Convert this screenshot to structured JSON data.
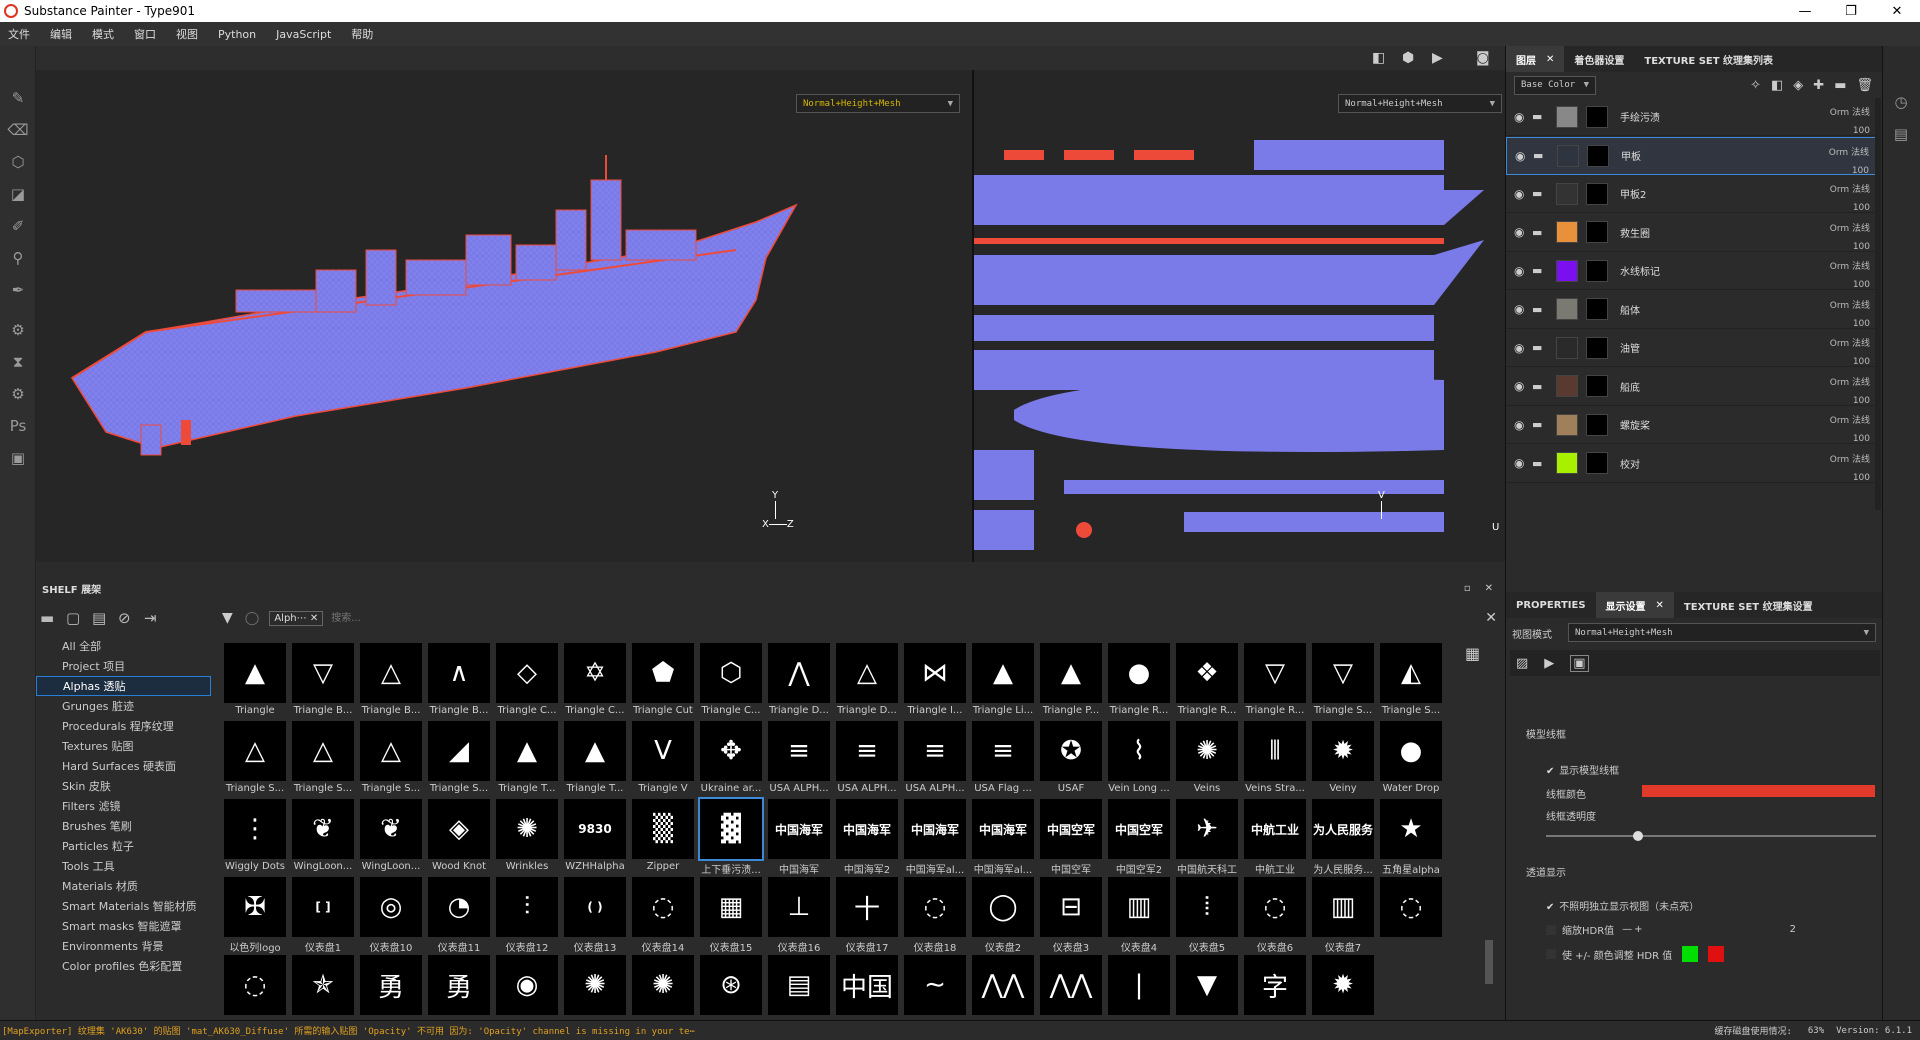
{
  "window": {
    "title": "Substance Painter - Type901",
    "minimize": "—",
    "maximize": "❐",
    "close": "✕"
  },
  "menu": [
    "文件",
    "编辑",
    "模式",
    "窗口",
    "视图",
    "Python",
    "JavaScript",
    "帮助"
  ],
  "viewport": {
    "mode_3d": "Normal+Height+Mesh",
    "mode_2d": "Normal+Height+Mesh",
    "axis_y": "Y",
    "axis_x": "X",
    "axis_z": "Z",
    "axis_u": "U",
    "axis_v": "V"
  },
  "shelf": {
    "title": "SHELF 展架",
    "filter_tag": "Alph⋯",
    "search_placeholder": "搜索...",
    "categories": [
      "All 全部",
      "Project 项目",
      "Alphas 透贴",
      "Grunges 脏迹",
      "Procedurals 程序纹理",
      "Textures 贴图",
      "Hard Surfaces 硬表面",
      "Skin 皮肤",
      "Filters 滤镜",
      "Brushes 笔刷",
      "Particles 粒子",
      "Tools 工具",
      "Materials 材质",
      "Smart Materials 智能材质",
      "Smart masks 智能遮罩",
      "Environments 背景",
      "Color profiles 色彩配置"
    ],
    "selected_category": "Alphas 透贴",
    "items": [
      {
        "label": "Triangle",
        "glyph": "▲"
      },
      {
        "label": "Triangle B...",
        "glyph": "▽"
      },
      {
        "label": "Triangle B...",
        "glyph": "△"
      },
      {
        "label": "Triangle B...",
        "glyph": "∧"
      },
      {
        "label": "Triangle C...",
        "glyph": "◇"
      },
      {
        "label": "Triangle C...",
        "glyph": "✡"
      },
      {
        "label": "Triangle Cut",
        "glyph": "⬟"
      },
      {
        "label": "Triangle C...",
        "glyph": "⬡"
      },
      {
        "label": "Triangle D...",
        "glyph": "⋀"
      },
      {
        "label": "Triangle D...",
        "glyph": "△"
      },
      {
        "label": "Triangle I...",
        "glyph": "⋈"
      },
      {
        "label": "Triangle Li...",
        "glyph": "▲"
      },
      {
        "label": "Triangle P...",
        "glyph": "▲"
      },
      {
        "label": "Triangle R...",
        "glyph": "●"
      },
      {
        "label": "Triangle R...",
        "glyph": "❖"
      },
      {
        "label": "Triangle R...",
        "glyph": "▽"
      },
      {
        "label": "Triangle S...",
        "glyph": "▽"
      },
      {
        "label": "Triangle S...",
        "glyph": "◭"
      },
      {
        "label": "Triangle S...",
        "glyph": "△"
      },
      {
        "label": "Triangle S...",
        "glyph": "△"
      },
      {
        "label": "Triangle S...",
        "glyph": "△"
      },
      {
        "label": "Triangle S...",
        "glyph": "◢"
      },
      {
        "label": "Triangle T...",
        "glyph": "▲"
      },
      {
        "label": "Triangle T...",
        "glyph": "▲"
      },
      {
        "label": "Triangle V",
        "glyph": "V"
      },
      {
        "label": "Ukraine ar...",
        "glyph": "✥"
      },
      {
        "label": "USA ALPH...",
        "glyph": "≡"
      },
      {
        "label": "USA ALPH...",
        "glyph": "≡"
      },
      {
        "label": "USA ALPH...",
        "glyph": "≡"
      },
      {
        "label": "USA Flag ...",
        "glyph": "≡"
      },
      {
        "label": "USAF",
        "glyph": "✪"
      },
      {
        "label": "Vein Long ...",
        "glyph": "⌇"
      },
      {
        "label": "Veins",
        "glyph": "✺"
      },
      {
        "label": "Veins Stra...",
        "glyph": "⦀"
      },
      {
        "label": "Veiny",
        "glyph": "✹"
      },
      {
        "label": "Water Drop",
        "glyph": "●"
      },
      {
        "label": "Wiggly Dots",
        "glyph": "⋮"
      },
      {
        "label": "WingLoon...",
        "glyph": "❦"
      },
      {
        "label": "WingLoon...",
        "glyph": "❦"
      },
      {
        "label": "Wood Knot",
        "glyph": "◈"
      },
      {
        "label": "Wrinkles",
        "glyph": "✺"
      },
      {
        "label": "WZHHalpha",
        "glyph": "9830"
      },
      {
        "label": "Zipper",
        "glyph": "▒"
      },
      {
        "label": "上下垂污渍...",
        "glyph": "▓"
      },
      {
        "label": "中国海军",
        "glyph": "中国海军"
      },
      {
        "label": "中国海军2",
        "glyph": "中国海军"
      },
      {
        "label": "中国海军al...",
        "glyph": "中国海军"
      },
      {
        "label": "中国海军al...",
        "glyph": "中国海军"
      },
      {
        "label": "中国空军",
        "glyph": "中国空军"
      },
      {
        "label": "中国空军2",
        "glyph": "中国空军"
      },
      {
        "label": "中国航天科工",
        "glyph": "✈"
      },
      {
        "label": "中航工业",
        "glyph": "中航工业"
      },
      {
        "label": "为人民服务...",
        "glyph": "为人民服务"
      },
      {
        "label": "五角星alpha",
        "glyph": "★"
      },
      {
        "label": "以色列logo",
        "glyph": "✠"
      },
      {
        "label": "仪表盘1",
        "glyph": "[ ]"
      },
      {
        "label": "仪表盘10",
        "glyph": "◎"
      },
      {
        "label": "仪表盘11",
        "glyph": "◔"
      },
      {
        "label": "仪表盘12",
        "glyph": "⫶"
      },
      {
        "label": "仪表盘13",
        "glyph": "( )"
      },
      {
        "label": "仪表盘14",
        "glyph": "◌"
      },
      {
        "label": "仪表盘15",
        "glyph": "▦"
      },
      {
        "label": "仪表盘16",
        "glyph": "⊥"
      },
      {
        "label": "仪表盘17",
        "glyph": "十"
      },
      {
        "label": "仪表盘18",
        "glyph": "◌"
      },
      {
        "label": "仪表盘2",
        "glyph": "◯"
      },
      {
        "label": "仪表盘3",
        "glyph": "⊟"
      },
      {
        "label": "仪表盘4",
        "glyph": "▥"
      },
      {
        "label": "仪表盘5",
        "glyph": "⦙"
      },
      {
        "label": "仪表盘6",
        "glyph": "◌"
      },
      {
        "label": "仪表盘7",
        "glyph": "▥"
      },
      {
        "label": "",
        "glyph": "◌"
      },
      {
        "label": "",
        "glyph": "◌"
      },
      {
        "label": "",
        "glyph": "✯"
      },
      {
        "label": "",
        "glyph": "勇"
      },
      {
        "label": "",
        "glyph": "勇"
      },
      {
        "label": "",
        "glyph": "◉"
      },
      {
        "label": "",
        "glyph": "✺"
      },
      {
        "label": "",
        "glyph": "✺"
      },
      {
        "label": "",
        "glyph": "⊛"
      },
      {
        "label": "",
        "glyph": "▤"
      },
      {
        "label": "",
        "glyph": "中国"
      },
      {
        "label": "",
        "glyph": "∼"
      },
      {
        "label": "",
        "glyph": "⋀⋀"
      },
      {
        "label": "",
        "glyph": "⋀⋀"
      },
      {
        "label": "",
        "glyph": "|"
      },
      {
        "label": "",
        "glyph": "▼"
      },
      {
        "label": "",
        "glyph": "字"
      },
      {
        "label": "",
        "glyph": "✹"
      }
    ],
    "selected_item": "上下垂污渍..."
  },
  "layers": {
    "tabs": [
      "图层",
      "着色器设置",
      "TEXTURE SET 纹理集列表"
    ],
    "channel": "Base Color",
    "items": [
      {
        "name": "手绘污渍",
        "blend": "Orm 法线",
        "opacity": "100",
        "color": "#888888"
      },
      {
        "name": "甲板",
        "blend": "Orm 法线",
        "opacity": "100",
        "color": "#2e3440"
      },
      {
        "name": "甲板2",
        "blend": "Orm 法线",
        "opacity": "100",
        "color": "#333333"
      },
      {
        "name": "救生圈",
        "blend": "Orm 法线",
        "opacity": "100",
        "color": "#e8903a"
      },
      {
        "name": "水线标记",
        "blend": "Orm 法线",
        "opacity": "100",
        "color": "#7a10f0"
      },
      {
        "name": "船体",
        "blend": "Orm 法线",
        "opacity": "100",
        "color": "#7a7a72"
      },
      {
        "name": "油管",
        "blend": "Orm 法线",
        "opacity": "100",
        "color": "#2a2a2a"
      },
      {
        "name": "船底",
        "blend": "Orm 法线",
        "opacity": "100",
        "color": "#5a3a30"
      },
      {
        "name": "螺旋桨",
        "blend": "Orm 法线",
        "opacity": "100",
        "color": "#a0805a"
      },
      {
        "name": "校对",
        "blend": "Orm 法线",
        "opacity": "100",
        "color": "#a8f000"
      }
    ],
    "selected": "甲板"
  },
  "properties": {
    "tabs": [
      "PROPERTIES",
      "显示设置",
      "TEXTURE SET 纹理集设置"
    ],
    "view_mode_label": "视图模式",
    "view_mode_value": "Normal+Height+Mesh",
    "section_wireframe": "模型线框",
    "show_wireframe": "显示模型线框",
    "wire_color_label": "线框颜色",
    "wire_color": "#e23a2a",
    "wire_opacity_label": "线框透明度",
    "wire_opacity": 0.28,
    "section_transparency": "透道显示",
    "isolate": "不照明独立显示视图（未点亮）",
    "hdr_label": "缩放HDR值",
    "hdr_minus": "—",
    "hdr_plus": "+",
    "hdr_value": "2",
    "color_adjust": "使 +/- 颜色调整 HDR 值",
    "plus_color": "#00dd00",
    "minus_color": "#e01010"
  },
  "status": {
    "message": "[MapExporter] 纹理集 'AK630' 的贴图 'mat_AK630_Diffuse' 所需的输入贴图 'Opacity' 不可用 因为: 'Opacity' channel is missing in your te⋯",
    "cache": "缓存磁盘使用情况:",
    "cache_value": "63%",
    "version": "Version: 6.1.1"
  },
  "colors": {
    "mesh_blue": "#7a7ae8",
    "wire_red": "#ee4a3a",
    "accent": "#2a7fd4"
  }
}
